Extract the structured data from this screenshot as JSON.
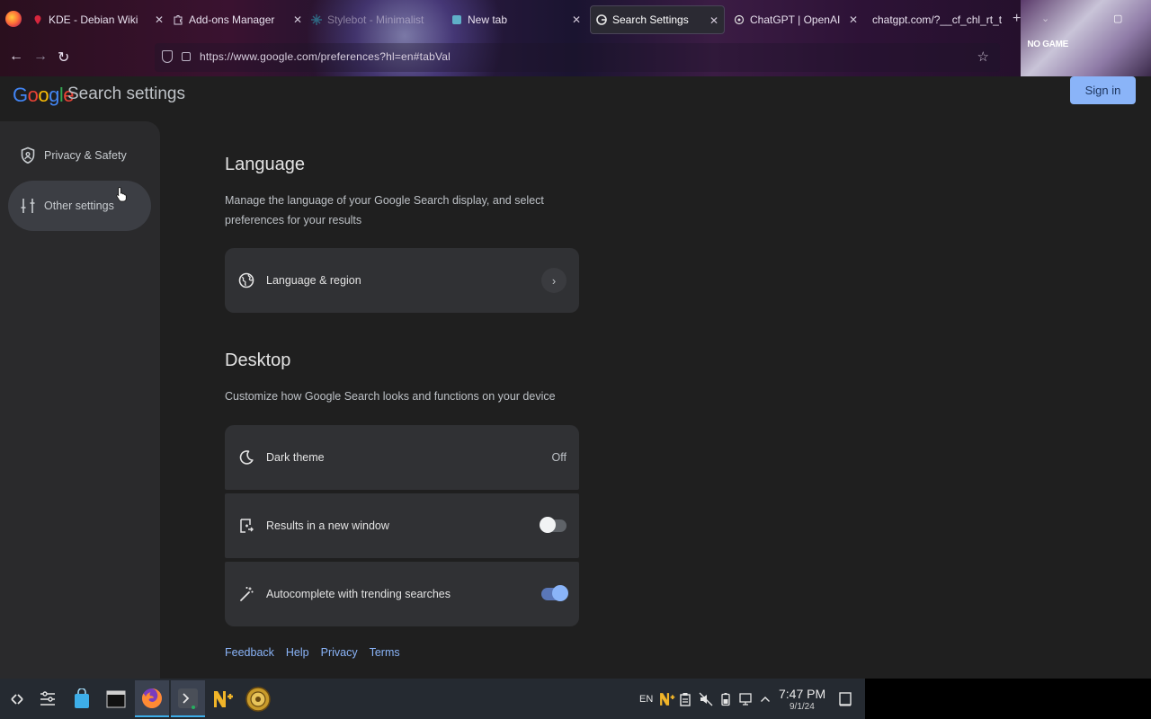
{
  "browser": {
    "tabs": [
      {
        "title": "KDE - Debian Wiki",
        "active": false
      },
      {
        "title": "Add-ons Manager",
        "active": false
      },
      {
        "title": "Stylebot - Minimalist",
        "active": false
      },
      {
        "title": "New tab",
        "active": false
      },
      {
        "title": "Search Settings",
        "active": true
      },
      {
        "title": "ChatGPT | OpenAI",
        "active": false
      },
      {
        "title": "chatgpt.com/?__cf_chl_rt_t",
        "active": false
      }
    ],
    "url": "https://www.google.com/preferences?hl=en#tabVal",
    "art_text": "NO GAME"
  },
  "header": {
    "logo": "Google",
    "title": "Search settings",
    "signin_label": "Sign in"
  },
  "sidebar": {
    "items": [
      {
        "label": "Privacy & Safety",
        "icon": "shield-icon",
        "selected": false
      },
      {
        "label": "Other settings",
        "icon": "sliders-icon",
        "selected": true
      }
    ]
  },
  "language": {
    "title": "Language",
    "description": "Manage the language of your Google Search display, and select preferences for your results",
    "card_label": "Language & region"
  },
  "desktop": {
    "title": "Desktop",
    "description": "Customize how Google Search looks and functions on your device",
    "dark_theme_label": "Dark theme",
    "dark_theme_value": "Off",
    "new_window_label": "Results in a new window",
    "new_window_on": false,
    "autocomplete_label": "Autocomplete with trending searches",
    "autocomplete_on": true
  },
  "footer": {
    "links": [
      "Feedback",
      "Help",
      "Privacy",
      "Terms"
    ]
  },
  "taskbar": {
    "lang": "EN",
    "time": "7:47 PM",
    "date": "9/1/24"
  },
  "colors": {
    "accent": "#8ab4f8",
    "card": "#303134",
    "background": "#1f1f1f"
  }
}
